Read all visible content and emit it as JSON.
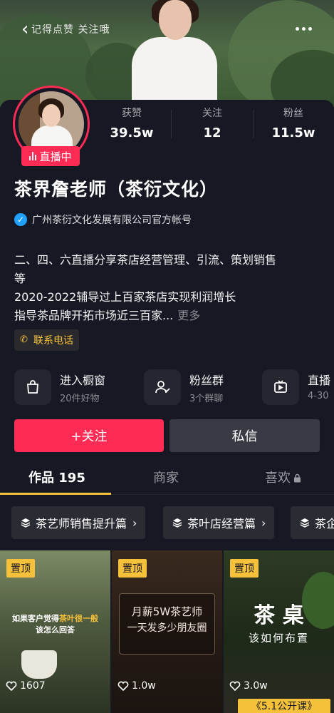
{
  "header": {
    "back_hint": "记得点赞 关注哦"
  },
  "profile": {
    "live_badge": "直播中",
    "stats": [
      {
        "label": "获赞",
        "value": "39.5w"
      },
      {
        "label": "关注",
        "value": "12"
      },
      {
        "label": "粉丝",
        "value": "11.5w"
      }
    ],
    "name": "茶界詹老师（茶衍文化）",
    "verified_text": "广州茶衍文化发展有限公司官方帐号",
    "bio": [
      "二、四、六直播分享茶店经营管理、引流、策划销售",
      "等",
      "2020-2022辅导过上百家茶店实现利润增长",
      "指导茶品牌开拓市场近三百家..."
    ],
    "bio_more": "更多",
    "phone_label": "联系电话"
  },
  "features": [
    {
      "title": "进入橱窗",
      "sub": "20件好物",
      "icon": "bag-icon"
    },
    {
      "title": "粉丝群",
      "sub": "3个群聊",
      "icon": "group-icon"
    },
    {
      "title": "直播",
      "sub": "4-30",
      "icon": "tv-icon"
    }
  ],
  "actions": {
    "follow": "+关注",
    "message": "私信"
  },
  "tabs": [
    {
      "label": "作品 195",
      "active": true
    },
    {
      "label": "商家",
      "active": false
    },
    {
      "label": "喜欢",
      "active": false,
      "locked": true
    }
  ],
  "chips": [
    {
      "label": "茶艺师销售提升篇"
    },
    {
      "label": "茶叶店经营篇"
    },
    {
      "label": "茶企"
    }
  ],
  "videos": [
    {
      "pin": "置顶",
      "likes": "1607",
      "caption_lines": [
        "如果客户觉得茶叶很一般",
        "该怎么回答"
      ],
      "highlight": "茶叶很一般"
    },
    {
      "pin": "置顶",
      "likes": "1.0w",
      "caption_lines": [
        "月薪5W茶艺师",
        "一天发多少朋友圈"
      ]
    },
    {
      "pin": "置顶",
      "likes": "3.0w",
      "caption_lines": [
        "茶 桌",
        "该如何布置"
      ],
      "bottom_tag": "《5.1公开课》"
    }
  ],
  "colors": {
    "background": "#161823",
    "accent": "#fe2c55",
    "gold": "#f5c13a",
    "verified": "#20a0ff"
  }
}
